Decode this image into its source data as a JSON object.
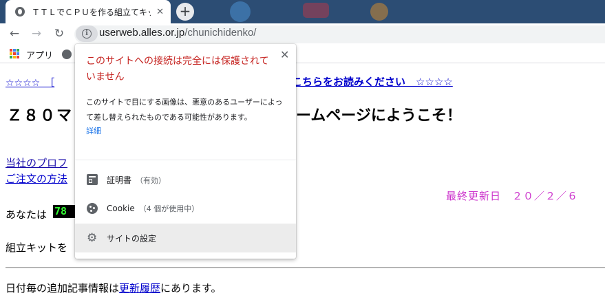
{
  "browser": {
    "tab_title": "ＴＴＬでＣＰＵを作る組立てキット",
    "tab_close": "✕",
    "new_tab": "+",
    "url_host": "userweb.alles.or.jp",
    "url_path": "/chunichidenko/",
    "bookmarks_apps_label": "アプリ"
  },
  "page": {
    "stars_left": "☆☆☆☆　［ ",
    "notice_link": "こちらをお読みください　☆☆☆☆",
    "heading_left": "Ｚ８０マ",
    "heading_right": "ームページにようこそ！",
    "profile_link": "当社のプロフ",
    "order_link": "ご注文の方法",
    "last_updated": "最終更新日　２０／２／６",
    "visitor_label": "あなたは",
    "counter_value": "78",
    "kit_text": "組立キットを",
    "daily_text_before": "日付毎の追加記事情報は",
    "daily_link": "更新履歴",
    "daily_text_after": "にあります。"
  },
  "popup": {
    "close": "✕",
    "warning": "このサイトへの接続は完全には保護されていません",
    "description": "このサイトで目にする画像は、悪意のあるユーザーによって差し替えられたものである可能性があります。",
    "details_link": "詳細",
    "certificate_label": "証明書",
    "certificate_status": "（有効）",
    "cookie_label": "Cookie",
    "cookie_status": "（4 個が使用中）",
    "site_settings_label": "サイトの設定"
  },
  "colors": {
    "warning_red": "#c5221f",
    "link_blue": "#0000cc",
    "update_magenta": "#cc33cc",
    "counter_green": "#33ff33"
  }
}
